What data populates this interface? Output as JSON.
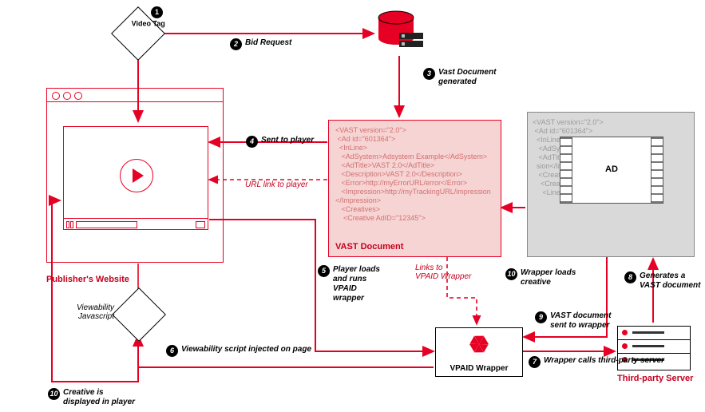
{
  "nodes": {
    "video_tag": "Video Tag",
    "publisher_website": "Publisher's Website",
    "viewability_js": "Viewability\nJavascript",
    "vast_document_title": "VAST Document",
    "vpaid_wrapper": "VPAID Wrapper",
    "third_party_server": "Third-party Server",
    "ad_label": "AD"
  },
  "annotations": {
    "url_link_to_player": "URL link to player",
    "links_to_vpaid_wrapper": "Links to\nVPAID Wrapper"
  },
  "vast_code": "<VAST version=\"2.0\">\n <Ad id=\"601364\">\n  <InLine>\n   <AdSystem>Adsystem Example</AdSystem>\n   <AdTitle>VAST 2.0</AdTitle>\n   <Description>VAST 2.0</Description>\n   <Error>http://myErrorURL/error</Error>\n   <Impression>http://myTrackingURL/impression</Impression>\n   <Creatives>\n    <Creative AdID=\"12345\">",
  "tp_code": "<VAST version=\"2.0\">\n <Ad id=\"601364\">\n  <InLine>\n   <AdSystem>Example</AdSystem>\n   <AdTitle>VAST 2.0</AdTitle>\n  sion</Impression>\n   <Creatives>\n    <Creative AdID=\"12345\">\n     <Linear>",
  "steps": {
    "1": "",
    "2": "Bid Request",
    "3": "Vast Document\ngenerated",
    "4": "Sent to player",
    "5": "Player loads\nand runs\nVPAID\nwrapper",
    "6": "Viewability script injected on page",
    "7": "Wrapper calls third-party server",
    "8": "Generates a\nVAST document",
    "9": "VAST document\nsent to wrapper",
    "10a": "Wrapper loads\ncreative",
    "10b": "Creative is\ndisplayed in player"
  }
}
